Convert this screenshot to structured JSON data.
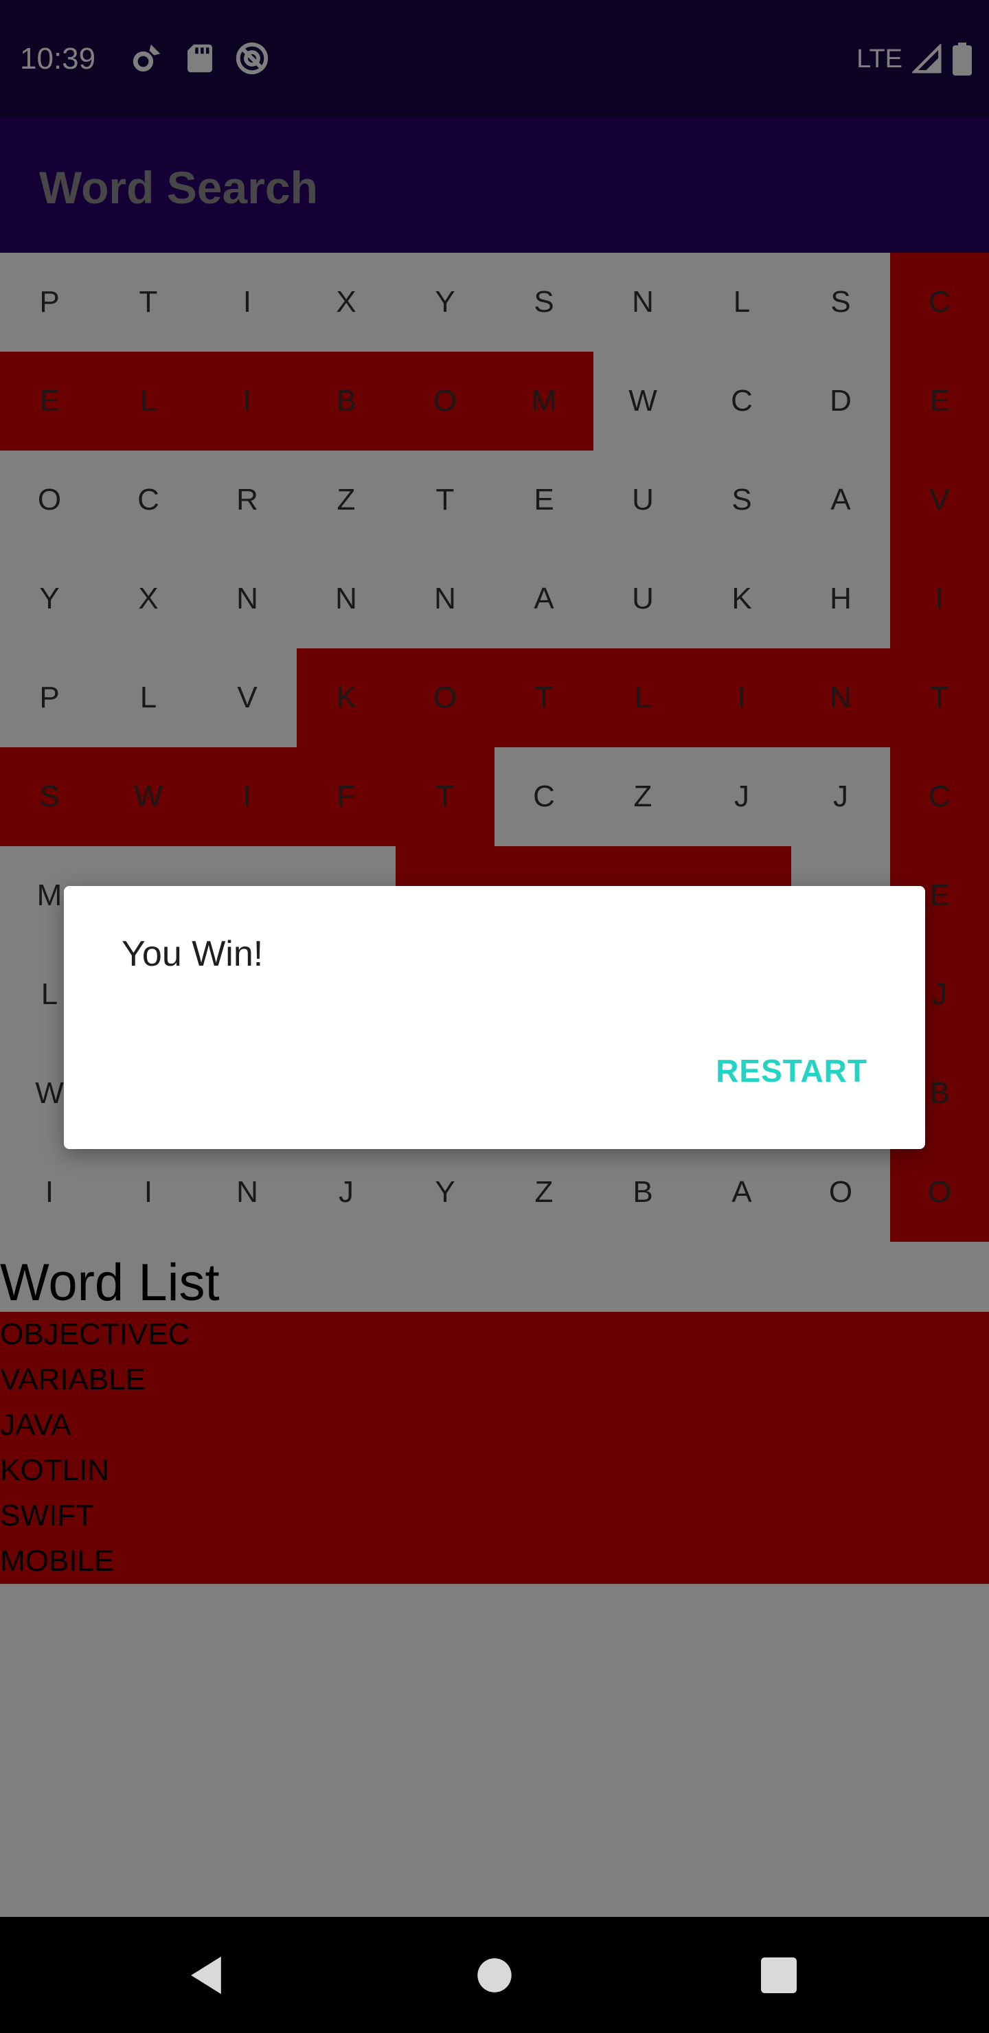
{
  "status_bar": {
    "time": "10:39",
    "network": "LTE",
    "icons": [
      "settings-gear-icon",
      "sd-card-icon",
      "sync-disabled-icon",
      "signal-icon",
      "battery-icon"
    ]
  },
  "app_bar": {
    "title": "Word Search"
  },
  "grid": {
    "rows": [
      [
        "P",
        "T",
        "I",
        "X",
        "Y",
        "S",
        "N",
        "L",
        "S",
        "C"
      ],
      [
        "E",
        "L",
        "I",
        "B",
        "O",
        "M",
        "W",
        "C",
        "D",
        "E"
      ],
      [
        "O",
        "C",
        "R",
        "Z",
        "T",
        "E",
        "U",
        "S",
        "A",
        "V"
      ],
      [
        "Y",
        "X",
        "N",
        "N",
        "N",
        "A",
        "U",
        "K",
        "H",
        "I"
      ],
      [
        "P",
        "L",
        "V",
        "K",
        "O",
        "T",
        "L",
        "I",
        "N",
        "T"
      ],
      [
        "S",
        "W",
        "I",
        "F",
        "T",
        "C",
        "Z",
        "J",
        "J",
        "C"
      ],
      [
        "M",
        "",
        "",
        "",
        "",
        "",
        "",
        "",
        "",
        "E"
      ],
      [
        "L",
        "",
        "",
        "",
        "",
        "",
        "",
        "",
        "",
        "J"
      ],
      [
        "W",
        "",
        "",
        "",
        "",
        "",
        "",
        "",
        "",
        "B"
      ],
      [
        "I",
        "I",
        "N",
        "J",
        "Y",
        "Z",
        "B",
        "A",
        "O",
        "O"
      ]
    ],
    "highlight_color": "#d70000"
  },
  "word_list": {
    "title": "Word List",
    "words": [
      "OBJECTIVEC",
      "VARIABLE",
      "JAVA",
      "KOTLIN",
      "SWIFT",
      "MOBILE"
    ]
  },
  "dialog": {
    "message": "You Win!",
    "button_label": "RESTART",
    "button_color": "#23d3c3"
  },
  "nav_bar": {
    "icons": [
      "back-icon",
      "home-icon",
      "recents-icon"
    ]
  }
}
